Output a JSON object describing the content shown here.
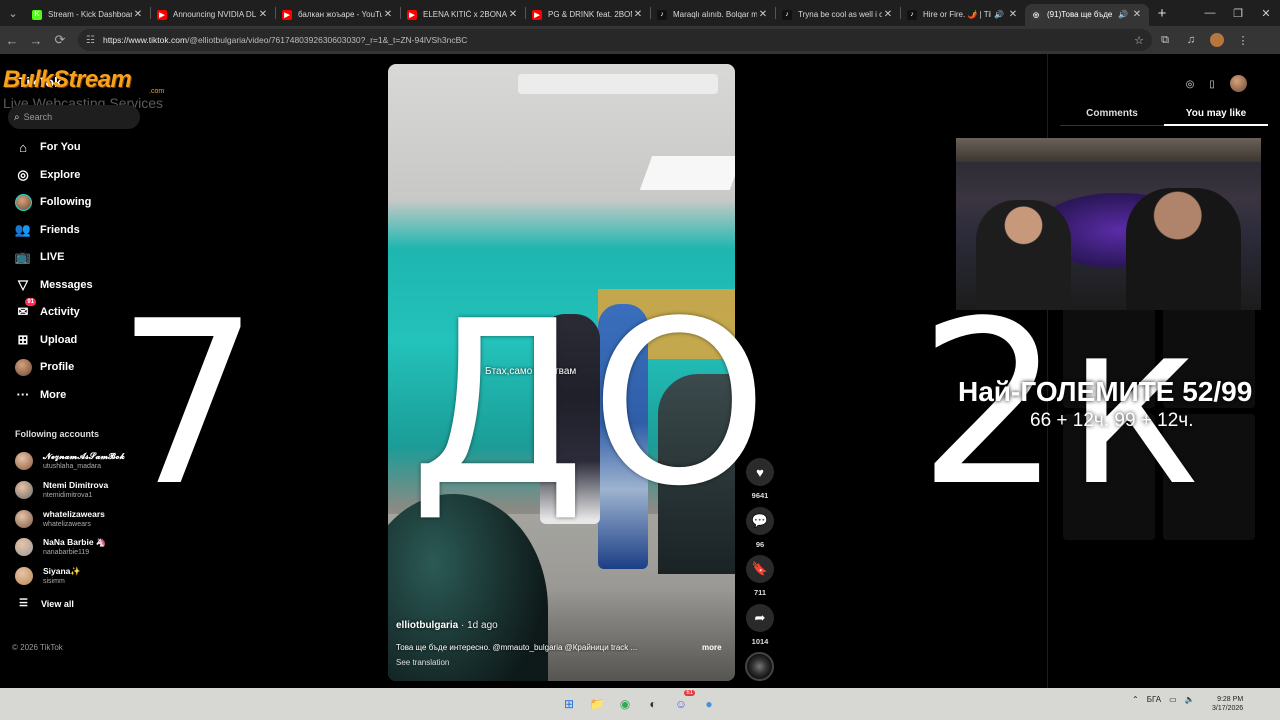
{
  "browser": {
    "tabs": [
      {
        "title": "Stream - Kick Dashboar",
        "favicon_color": "#53fc18",
        "favicon_glyph": "K",
        "icon": "kick-icon",
        "active": false
      },
      {
        "title": "Announcing NVIDIA DL",
        "favicon_color": "#ff0000",
        "favicon_glyph": "▶",
        "icon": "youtube-icon",
        "active": false
      },
      {
        "title": "балкан жоъаре - YouTu",
        "favicon_color": "#ff0000",
        "favicon_glyph": "▶",
        "icon": "youtube-icon",
        "active": false
      },
      {
        "title": "ELENA KITIĆ x 2BONA -",
        "favicon_color": "#ff0000",
        "favicon_glyph": "▶",
        "icon": "youtube-icon",
        "active": false
      },
      {
        "title": "PG & DRINK feat. 2BON",
        "favicon_color": "#ff0000",
        "favicon_glyph": "▶",
        "icon": "youtube-icon",
        "active": false
      },
      {
        "title": "Maraqlı alınıb. Bolqar m",
        "favicon_color": "#111111",
        "favicon_glyph": "♪",
        "icon": "tiktok-icon",
        "active": false
      },
      {
        "title": "Tryna be cool as well i c",
        "favicon_color": "#111111",
        "favicon_glyph": "♪",
        "icon": "tiktok-icon",
        "active": false
      },
      {
        "title": "Hire or Fire. 🌶️ | Tik",
        "favicon_color": "#111111",
        "favicon_glyph": "♪",
        "icon": "tiktok-icon",
        "audio": true,
        "active": false
      },
      {
        "title": "(91)Това ще бъде и",
        "favicon_color": "#3a3a3a",
        "favicon_glyph": "◎",
        "icon": "tiktok-icon",
        "audio": true,
        "active": true
      }
    ],
    "url_host": "https://www.tiktok.com",
    "url_path": "/@elliotbulgaria/video/7617480392630603030?_r=1&_t=ZN-94lVSh3ncBC"
  },
  "watermark": {
    "main": "BulkStream",
    "com": ".com",
    "sub": "Live Webcasting Services"
  },
  "sidebar": {
    "logo": "TikTok",
    "search_placeholder": "Search",
    "nav": [
      {
        "label": "For You",
        "icon": "home-icon",
        "glyph": "⌂"
      },
      {
        "label": "Explore",
        "icon": "compass-icon",
        "glyph": "◎"
      },
      {
        "label": "Following",
        "icon": "following-avatar-icon",
        "glyph": "",
        "avatar": true
      },
      {
        "label": "Friends",
        "icon": "friends-icon",
        "glyph": "👥"
      },
      {
        "label": "LIVE",
        "icon": "live-tv-icon",
        "glyph": "📺"
      },
      {
        "label": "Messages",
        "icon": "messages-icon",
        "glyph": "▽"
      },
      {
        "label": "Activity",
        "icon": "activity-icon",
        "glyph": "✉",
        "badge": "91"
      },
      {
        "label": "Upload",
        "icon": "upload-icon",
        "glyph": "⊞"
      },
      {
        "label": "Profile",
        "icon": "profile-avatar-icon",
        "glyph": "",
        "avatar_plain": true
      },
      {
        "label": "More",
        "icon": "more-icon",
        "glyph": "···"
      }
    ],
    "following_title": "Following accounts",
    "accounts": [
      {
        "name": "𝓝𝓮𝔃𝓷𝓪𝓶𝓐𝓼𝓢𝓪𝓶𝓑𝓸𝓴",
        "handle": "utushlaha_madara",
        "color": "#8a5a40"
      },
      {
        "name": "Ntemi Dimitrova",
        "handle": "ntemidimitrova1",
        "color": "#6b6b6b"
      },
      {
        "name": "whatelizawears",
        "handle": "whatelizawears",
        "color": "#7a5b4c"
      },
      {
        "name": "NaNa Barbie 🦄",
        "handle": "nanabarbie119",
        "color": "#9a9a9a"
      },
      {
        "name": "Siyana✨",
        "handle": "sisimm",
        "color": "#b88a5a"
      }
    ],
    "view_all": "View all",
    "copyright": "© 2026 TikTok"
  },
  "video": {
    "subtitle": "Бтах,само загатвам",
    "author": "elliotbulgaria",
    "posted": "· 1d ago",
    "caption": "Това ще бъде интересно. @mmauto_bulgaria @Крайници track ...",
    "more": "more",
    "see_translation": "See translation"
  },
  "actions": [
    {
      "name": "like-button",
      "icon": "heart-icon",
      "glyph": "♥",
      "count": "9641"
    },
    {
      "name": "comment-button",
      "icon": "comment-icon",
      "glyph": "💬",
      "count": "96"
    },
    {
      "name": "bookmark-button",
      "icon": "bookmark-icon",
      "glyph": "🔖",
      "count": "711"
    },
    {
      "name": "share-button",
      "icon": "share-icon",
      "glyph": "➦",
      "count": "1014"
    }
  ],
  "right_panel": {
    "tab_comments": "Comments",
    "tab_you_may_like": "You may like"
  },
  "overlay": {
    "big_text_parts": [
      "7",
      "ДО",
      "2к"
    ],
    "title": "Най-ГОЛЕМИТЕ 52/99",
    "subtitle": "66 + 12ч. 99 + 12ч."
  },
  "taskbar": {
    "apps": [
      {
        "icon": "windows-start-icon",
        "glyph": "⊞",
        "color": "#1a73e8"
      },
      {
        "icon": "file-explorer-icon",
        "glyph": "📁",
        "color": "#f2c14e"
      },
      {
        "icon": "chrome-icon",
        "glyph": "◉",
        "color": "#34a853"
      },
      {
        "icon": "obs-icon",
        "glyph": "◐",
        "color": "#333333"
      },
      {
        "icon": "discord-icon",
        "glyph": "☺",
        "color": "#5865f2",
        "badge": "61"
      },
      {
        "icon": "app-icon",
        "glyph": "●",
        "color": "#4a90d9"
      }
    ],
    "lang": "БГА",
    "time": "9:28 PM",
    "date": "3/17/2026"
  }
}
